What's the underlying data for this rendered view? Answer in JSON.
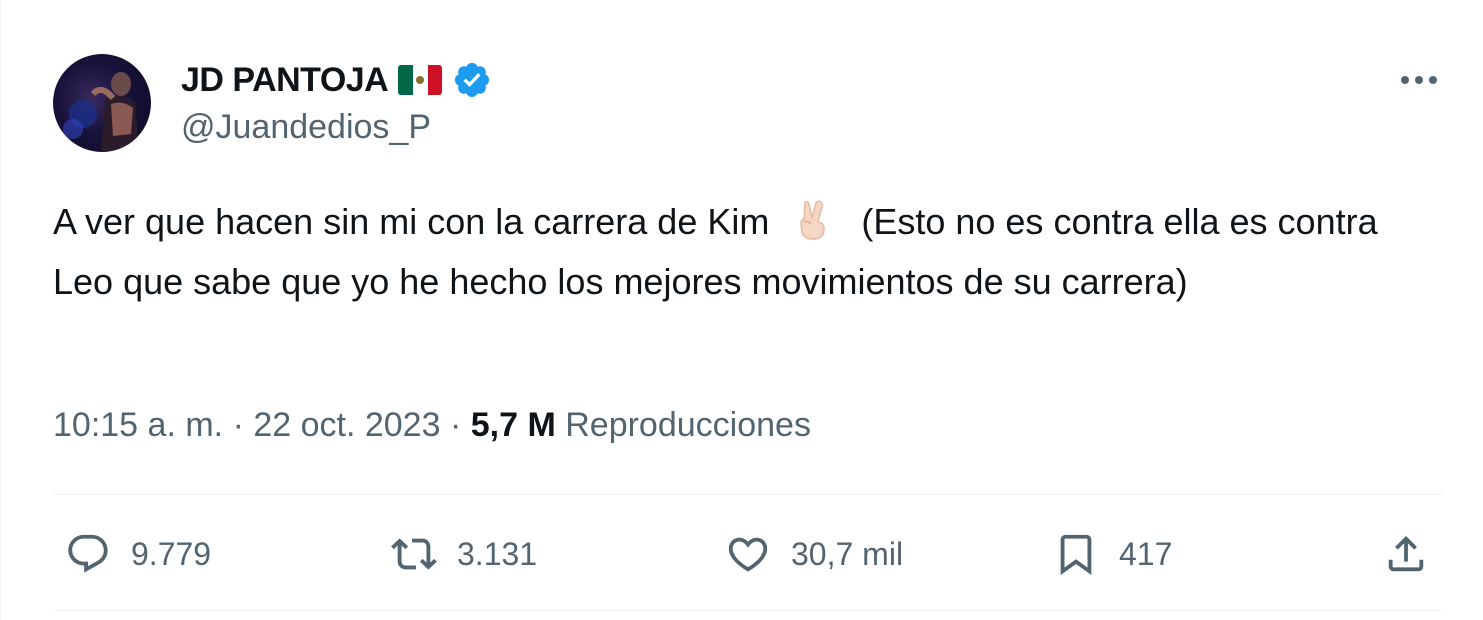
{
  "author": {
    "display_name": "JD PANTOJA",
    "flag": "Mexico flag",
    "verified_icon": "verified-badge-icon",
    "handle": "@Juandedios_P"
  },
  "tweet": {
    "text_part1": "A ver que hacen sin mi con la carrera de Kim",
    "emoji": "victory-hand-emoji",
    "text_part2": "(Esto no es contra ella es contra Leo que sabe que yo he hecho los mejores movimientos de su carrera)"
  },
  "meta": {
    "time": "10:15 a. m.",
    "separator": "·",
    "date": "22 oct. 2023",
    "views_count": "5,7 M",
    "views_label": "Reproducciones"
  },
  "actions": {
    "replies": "9.779",
    "reposts": "3.131",
    "likes": "30,7 mil",
    "bookmarks": "417"
  },
  "colors": {
    "text_primary": "#0f1419",
    "text_secondary": "#536471",
    "verified_blue": "#1d9bf0",
    "divider": "#eff3f4"
  }
}
